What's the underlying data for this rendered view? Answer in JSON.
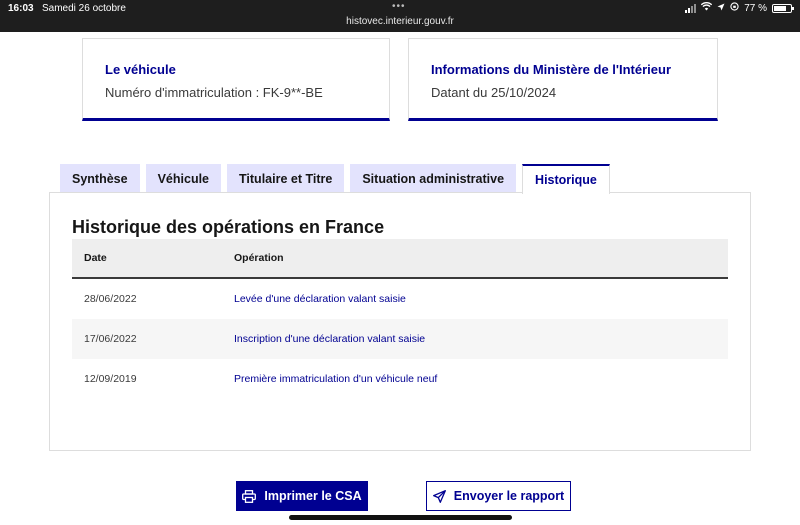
{
  "status_bar": {
    "time": "16:03",
    "date": "Samedi 26 octobre",
    "url": "histovec.interieur.gouv.fr",
    "battery": "77 %",
    "battery_level": 0.77
  },
  "cards": [
    {
      "title": "Le véhicule",
      "text": "Numéro d'immatriculation : FK-9**-BE"
    },
    {
      "title": "Informations du Ministère de l'Intérieur",
      "text": "Datant du 25/10/2024"
    }
  ],
  "tabs": [
    {
      "label": "Synthèse"
    },
    {
      "label": "Véhicule"
    },
    {
      "label": "Titulaire et Titre"
    },
    {
      "label": "Situation administrative"
    },
    {
      "label": "Historique"
    }
  ],
  "history": {
    "title": "Historique des opérations en France",
    "columns": {
      "date": "Date",
      "operation": "Opération"
    },
    "rows": [
      {
        "date": "28/06/2022",
        "operation": "Levée d'une déclaration valant saisie"
      },
      {
        "date": "17/06/2022",
        "operation": "Inscription d'une déclaration valant saisie"
      },
      {
        "date": "12/09/2019",
        "operation": "Première immatriculation d'un véhicule neuf"
      }
    ]
  },
  "actions": {
    "print_label": "Imprimer le CSA",
    "send_label": "Envoyer le rapport"
  },
  "colors": {
    "primary": "#000091",
    "tab_inactive": "#e3e3fd",
    "status_bar": "#1e1e1e"
  }
}
